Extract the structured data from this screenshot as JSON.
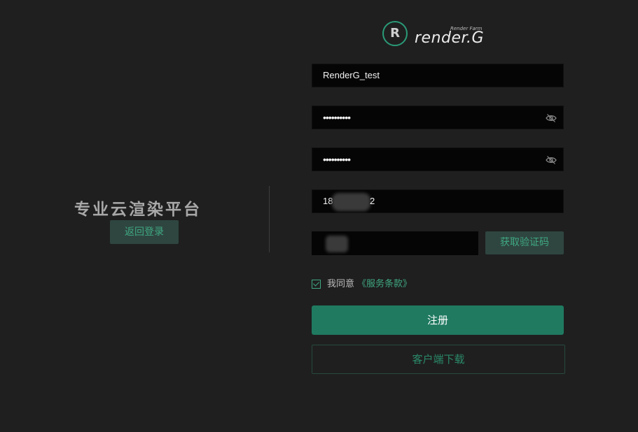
{
  "left": {
    "platform_title": "专业云渲染平台",
    "back_button": "返回登录"
  },
  "logo": {
    "mark": "R",
    "small_text": "Render Farm",
    "name": "render.G"
  },
  "form": {
    "username": "RenderG_test",
    "password": "••••••••••",
    "confirm_password": "••••••••••",
    "phone_prefix": "18",
    "phone_suffix": "2",
    "code_button": "获取验证码",
    "agree_text": "我同意",
    "terms_link": "《服务条款》",
    "register_button": "注册",
    "download_button": "客户端下载"
  },
  "icons": {
    "password_toggle": "eye-off-icon",
    "confirm_toggle": "eye-off-icon",
    "checkbox": "checkbox-checked-icon"
  },
  "colors": {
    "background": "#1f1f1f",
    "accent": "#1f7a60",
    "accent_text": "#3fa882"
  }
}
